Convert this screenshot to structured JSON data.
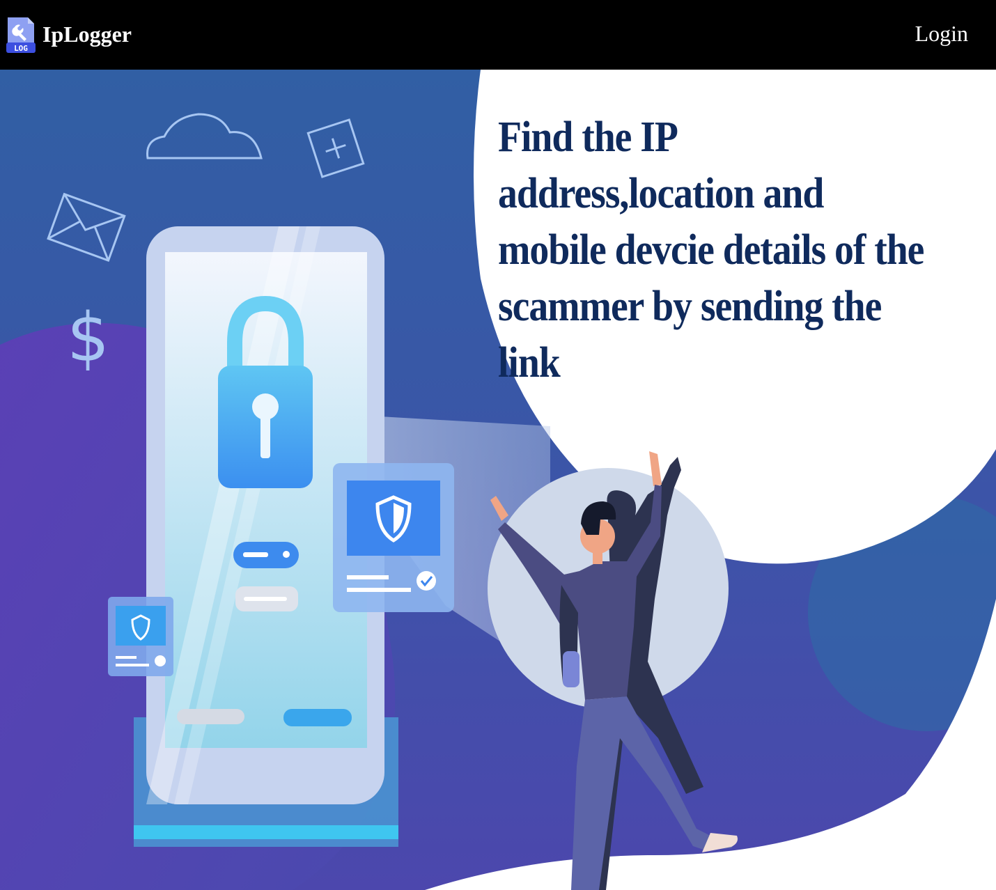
{
  "navbar": {
    "brand_name": "IpLogger",
    "logo_badge_text": "LOG",
    "logo_icon": "wrench-icon",
    "login_label": "Login"
  },
  "hero": {
    "headline": "Find the IP address,location and mobile devcie details of the scammer by sending the link",
    "illustration_icons": [
      "cloud-icon",
      "plus-card-icon",
      "envelope-icon",
      "dollar-icon",
      "padlock-icon",
      "shield-icon",
      "checkmark-icon"
    ]
  },
  "colors": {
    "navbar_bg": "#000000",
    "headline": "#0f2a5c",
    "hero_blue": "#3d5aa6",
    "hero_purple": "#5a3fb0",
    "accent_cyan": "#4fb8f0"
  }
}
